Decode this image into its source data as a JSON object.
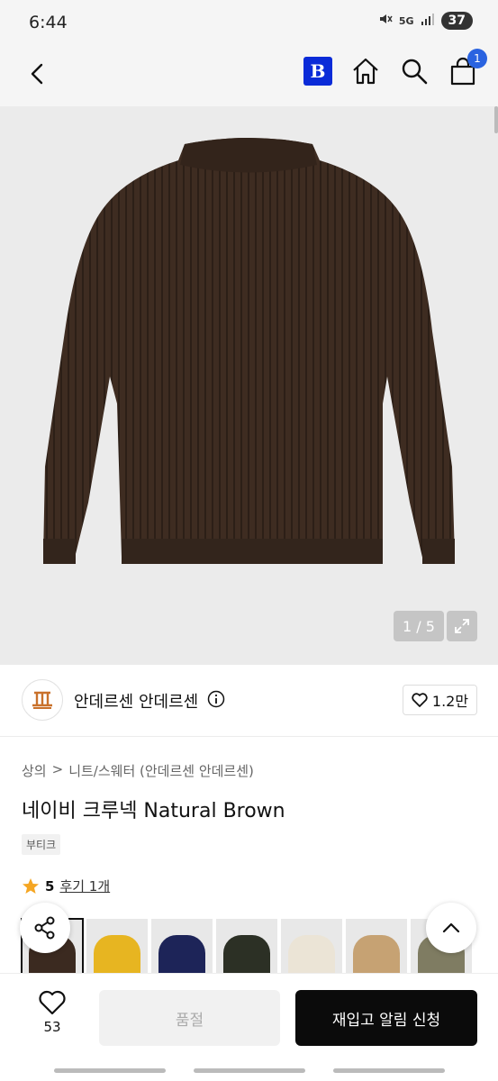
{
  "status_bar": {
    "time": "6:44",
    "network": "5G",
    "battery": "37"
  },
  "nav": {
    "b_badge": "B",
    "cart_count": "1"
  },
  "gallery": {
    "counter": "1 / 5",
    "sweater_color": "#3b2a20"
  },
  "brand": {
    "name": "안데르센 안데르센",
    "likes": "1.2만"
  },
  "product": {
    "breadcrumb": [
      "상의",
      ">",
      "니트/스웨터 (안데르센 안데르센)"
    ],
    "title": "네이비 크루넥 Natural Brown",
    "tag": "부티크",
    "rating": "5",
    "reviews": "후기 1개"
  },
  "color_options": [
    {
      "name": "brown",
      "color": "#3b2a20"
    },
    {
      "name": "yellow",
      "color": "#e7b521"
    },
    {
      "name": "navy",
      "color": "#1d2458"
    },
    {
      "name": "dark-green",
      "color": "#2c3025"
    },
    {
      "name": "cream",
      "color": "#ebe4d6"
    },
    {
      "name": "camel",
      "color": "#c6a273"
    },
    {
      "name": "olive",
      "color": "#7f7c62"
    }
  ],
  "bottom_bar": {
    "wish_count": "53",
    "soldout_label": "품절",
    "restock_label": "재입고 알림 신청"
  },
  "colors": {
    "accent_blue": "#0a2bd8",
    "cart_badge": "#2a63e0",
    "star": "#f5a623",
    "primary_button": "#0b0b0b"
  }
}
